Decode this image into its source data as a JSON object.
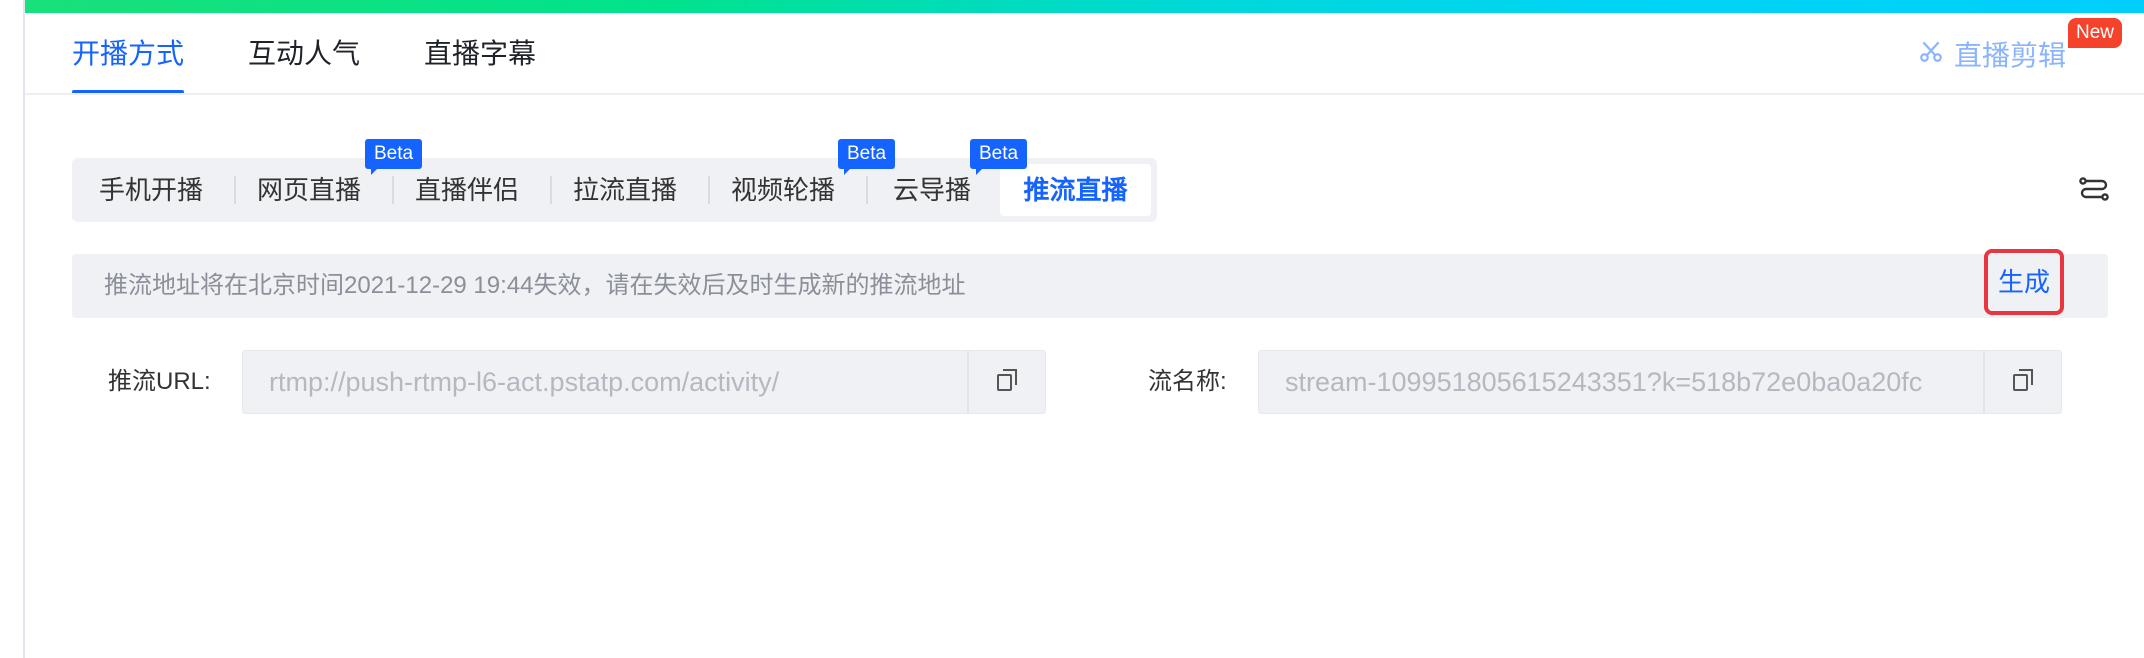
{
  "top_tabs": [
    {
      "label": "开播方式",
      "active": true
    },
    {
      "label": "互动人气",
      "active": false
    },
    {
      "label": "直播字幕",
      "active": false
    }
  ],
  "clip_link": {
    "label": "直播剪辑",
    "icon": "scissors-icon",
    "badge": "New"
  },
  "modes": [
    {
      "label": "手机开播",
      "badge": ""
    },
    {
      "label": "网页直播",
      "badge": "Beta"
    },
    {
      "label": "直播伴侣",
      "badge": ""
    },
    {
      "label": "拉流直播",
      "badge": ""
    },
    {
      "label": "视频轮播",
      "badge": "Beta"
    },
    {
      "label": "云导播",
      "badge": "Beta"
    },
    {
      "label": "推流直播",
      "badge": "",
      "active": true
    }
  ],
  "settings_icon": "settings-sliders-icon",
  "notice": {
    "text": "推流地址将在北京时间2021-12-29 19:44失效，请在失效后及时生成新的推流地址",
    "button_label": "生成"
  },
  "push_url": {
    "label": "推流URL:",
    "value": "rtmp://push-rtmp-l6-act.pstatp.com/activity/",
    "icon": "copy-icon"
  },
  "stream_name": {
    "label": "流名称:",
    "value": "stream-109951805615243351?k=518b72e0ba0a20fc",
    "icon": "copy-icon"
  },
  "colors": {
    "accent": "#1664ff",
    "badge_new": "#f5422a",
    "highlight_border": "#e8353f"
  }
}
